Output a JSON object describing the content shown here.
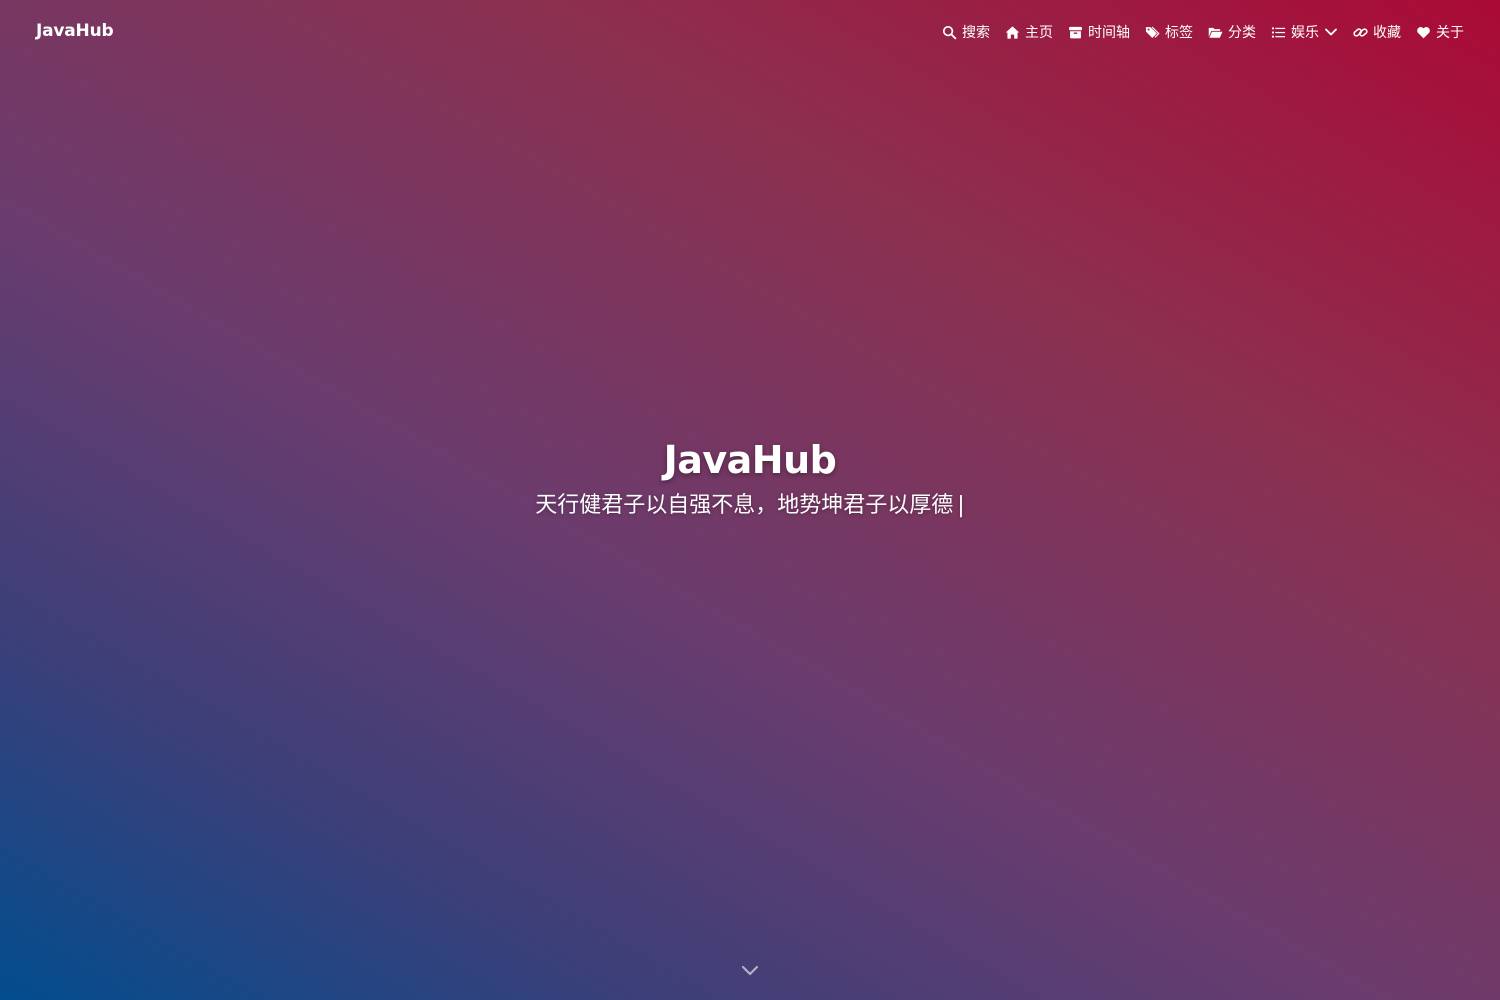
{
  "navbar": {
    "brand": "JavaHub",
    "items": [
      {
        "label": "搜索",
        "icon": "search-icon"
      },
      {
        "label": "主页",
        "icon": "home-icon"
      },
      {
        "label": "时间轴",
        "icon": "archive-icon"
      },
      {
        "label": "标签",
        "icon": "tags-icon"
      },
      {
        "label": "分类",
        "icon": "folder-open-icon"
      },
      {
        "label": "娱乐",
        "icon": "list-icon",
        "has_dropdown": true
      },
      {
        "label": "收藏",
        "icon": "link-icon"
      },
      {
        "label": "关于",
        "icon": "heart-icon"
      }
    ]
  },
  "hero": {
    "title": "JavaHub",
    "subtitle": "天行健君子以自强不息，地势坤君子以厚德",
    "cursor": "|"
  },
  "scroll_indicator": {
    "icon": "chevron-down-icon"
  },
  "colors": {
    "gradient_bottom_left": "#024d8e",
    "gradient_mid": "#6a3c6e",
    "gradient_top_right": "#aa0a36",
    "text": "#ffffff"
  }
}
